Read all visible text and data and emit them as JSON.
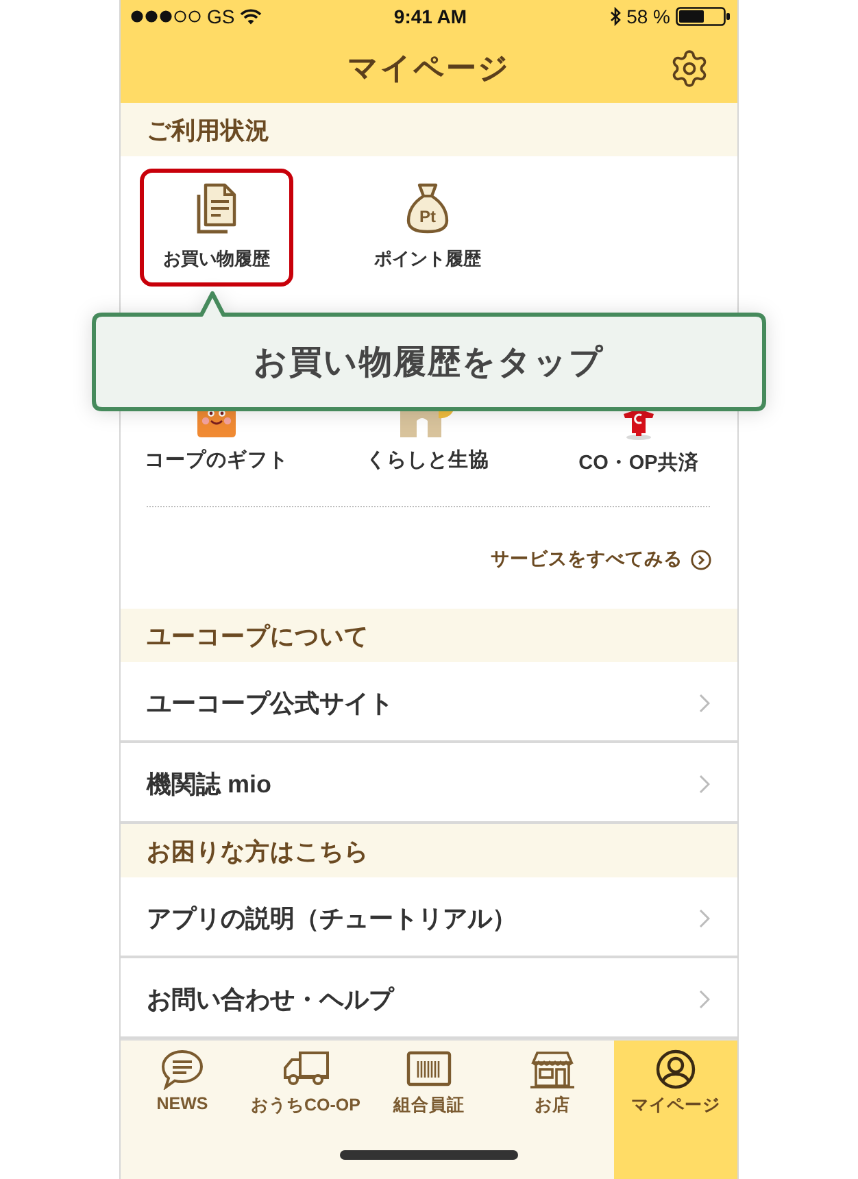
{
  "status_bar": {
    "carrier": "GS",
    "time": "9:41 AM",
    "battery": "58 %"
  },
  "header": {
    "title": "マイページ"
  },
  "usage": {
    "heading": "ご利用状況",
    "items": [
      {
        "kind": "receipt",
        "label": "お買い物履歴",
        "highlighted": true
      },
      {
        "kind": "points",
        "label": "ポイント履歴",
        "icon_text": "Pt",
        "highlighted": false
      }
    ]
  },
  "callout": {
    "text": "お買い物履歴をタップ"
  },
  "services": {
    "items": [
      {
        "kind": "gift",
        "label": "コープのギフト"
      },
      {
        "kind": "house",
        "label": "くらしと生協"
      },
      {
        "kind": "mascot",
        "label": "CO・OP共済"
      }
    ],
    "more_link": "サービスをすべてみる"
  },
  "sections": [
    {
      "heading": "ユーコープについて",
      "rows": [
        {
          "label": "ユーコープ公式サイト"
        },
        {
          "label": "機関誌 mio"
        }
      ]
    },
    {
      "heading": "お困りな方はこちら",
      "rows": [
        {
          "label": "アプリの説明（チュートリアル）"
        },
        {
          "label": "お問い合わせ・ヘルプ"
        }
      ]
    }
  ],
  "tab_bar": [
    {
      "kind": "news",
      "label": "NEWS",
      "selected": false
    },
    {
      "kind": "truck",
      "label": "おうちCO-OP",
      "selected": false
    },
    {
      "kind": "card",
      "label": "組合員証",
      "selected": false
    },
    {
      "kind": "store",
      "label": "お店",
      "selected": false
    },
    {
      "kind": "user",
      "label": "マイページ",
      "selected": true
    }
  ]
}
